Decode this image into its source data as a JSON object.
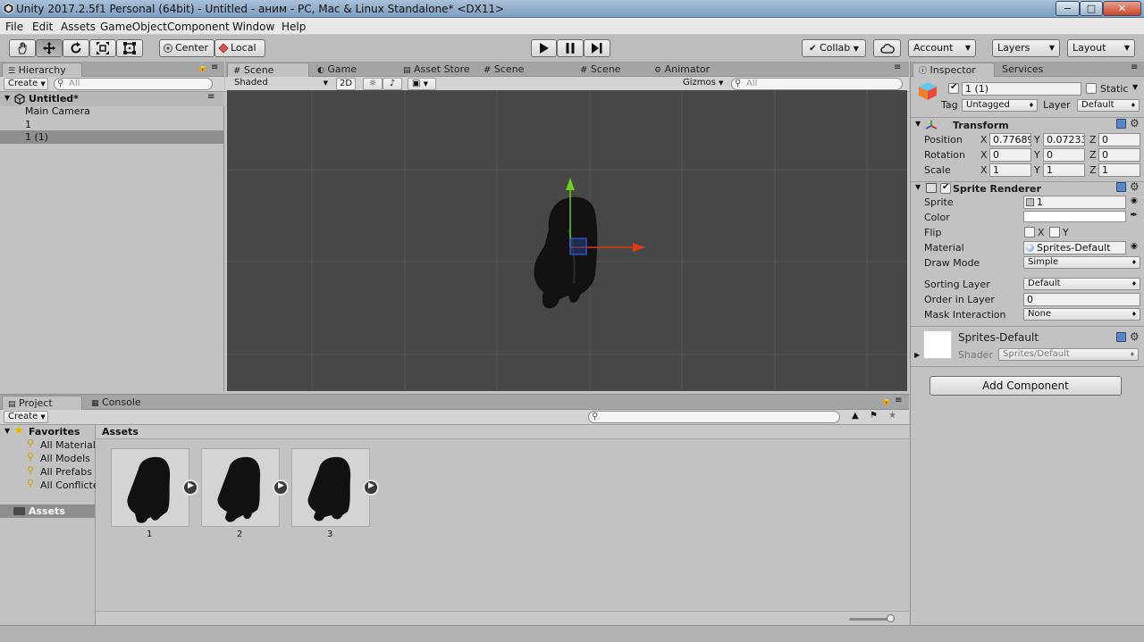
{
  "window": {
    "title": "Unity 2017.2.5f1 Personal (64bit) - Untitled - аним - PC, Mac & Linux Standalone* <DX11>",
    "min_label": "−",
    "max_label": "□",
    "close_label": "✕"
  },
  "menu": [
    "File",
    "Edit",
    "Assets",
    "GameObject",
    "Component",
    "Window",
    "Help"
  ],
  "toolbar": {
    "pivot": "Center",
    "space": "Local",
    "collab": "Collab",
    "account": "Account",
    "layers": "Layers",
    "layout": "Layout"
  },
  "hierarchy": {
    "tab": "Hierarchy",
    "create": "Create",
    "search_placeholder": "All",
    "scene": "Untitled*",
    "items": [
      "Main Camera",
      "1",
      "1 (1)"
    ]
  },
  "scene_tabs": [
    "Scene",
    "Game",
    "Asset Store",
    "Scene",
    "Scene",
    "Animator"
  ],
  "scene_bar": {
    "shading": "Shaded",
    "mode2d": "2D",
    "gizmos": "Gizmos",
    "search_placeholder": "All"
  },
  "project": {
    "tabs": [
      "Project",
      "Console"
    ],
    "create": "Create",
    "favorites_label": "Favorites",
    "favorites": [
      "All Materials",
      "All Models",
      "All Prefabs",
      "All Conflicted"
    ],
    "assets_root": "Assets",
    "breadcrumb": "Assets",
    "assets": [
      "1",
      "2",
      "3"
    ]
  },
  "inspector": {
    "tabs": [
      "Inspector",
      "Services"
    ],
    "object_name": "1 (1)",
    "static_label": "Static",
    "tag_label": "Tag",
    "tag_value": "Untagged",
    "layer_label": "Layer",
    "layer_value": "Default",
    "transform": {
      "title": "Transform",
      "rows": [
        {
          "label": "Position",
          "x": "0.77689",
          "y": "0.07233",
          "z": "0"
        },
        {
          "label": "Rotation",
          "x": "0",
          "y": "0",
          "z": "0"
        },
        {
          "label": "Scale",
          "x": "1",
          "y": "1",
          "z": "1"
        }
      ],
      "axis": [
        "X",
        "Y",
        "Z"
      ]
    },
    "sprite_renderer": {
      "title": "Sprite Renderer",
      "sprite_label": "Sprite",
      "sprite_value": "1",
      "color_label": "Color",
      "color_value": "#ffffff",
      "flip_label": "Flip",
      "flip_x": "X",
      "flip_y": "Y",
      "material_label": "Material",
      "material_value": "Sprites-Default",
      "draw_mode_label": "Draw Mode",
      "draw_mode_value": "Simple",
      "sorting_layer_label": "Sorting Layer",
      "sorting_layer_value": "Default",
      "order_label": "Order in Layer",
      "order_value": "0",
      "mask_label": "Mask Interaction",
      "mask_value": "None"
    },
    "material": {
      "name": "Sprites-Default",
      "shader_label": "Shader",
      "shader_value": "Sprites/Default"
    },
    "add_component": "Add Component"
  },
  "colors": {
    "scene_bg": "#474747",
    "grid": "#575757",
    "selection": "#8e8e8e",
    "x_axis": "#e0391d",
    "y_axis": "#6fcf1f"
  }
}
